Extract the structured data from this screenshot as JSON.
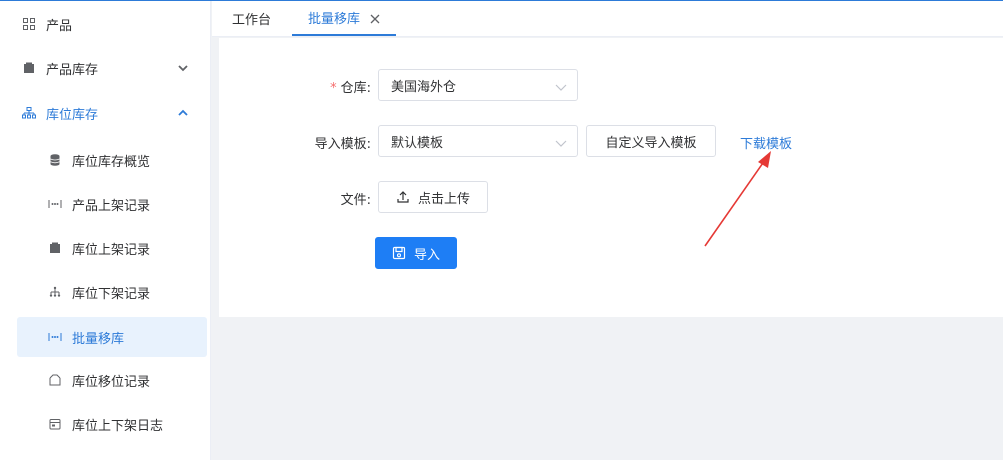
{
  "sidebar": {
    "items": [
      {
        "label": "产品",
        "icon": "grid-icon"
      },
      {
        "label": "产品库存",
        "icon": "box-icon"
      },
      {
        "label": "库位库存",
        "icon": "sitemap-icon"
      }
    ],
    "sub_items": [
      {
        "label": "库位库存概览",
        "icon": "database-icon"
      },
      {
        "label": "产品上架记录",
        "icon": "dots-icon"
      },
      {
        "label": "库位上架记录",
        "icon": "box-icon"
      },
      {
        "label": "库位下架记录",
        "icon": "tree-icon"
      },
      {
        "label": "批量移库",
        "icon": "dots-icon"
      },
      {
        "label": "库位移位记录",
        "icon": "shelf-icon"
      },
      {
        "label": "库位上下架日志",
        "icon": "calendar-icon"
      }
    ]
  },
  "tabs": [
    {
      "label": "工作台"
    },
    {
      "label": "批量移库"
    }
  ],
  "form": {
    "warehouse_label": "仓库:",
    "required_mark": "*",
    "warehouse_value": "美国海外仓",
    "template_label": "导入模板:",
    "template_value": "默认模板",
    "custom_template_button": "自定义导入模板",
    "download_template_link": "下载模板",
    "file_label": "文件:",
    "upload_button": "点击上传",
    "import_button": "导入"
  },
  "colors": {
    "accent": "#2d7bd8",
    "primary_button": "#1e7ef5",
    "required": "#f56c6c",
    "annotation_arrow": "#e53935"
  }
}
